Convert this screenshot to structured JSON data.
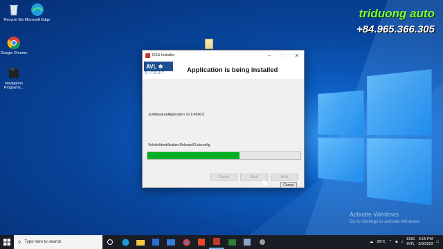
{
  "desktop": {
    "icons": [
      {
        "label": "Recycle Bin"
      },
      {
        "label": "Microsoft Edge"
      },
      {
        "label": "Google Chrome"
      },
      {
        "label": "Navigation Programs..."
      }
    ]
  },
  "watermark": {
    "title": "triduong auto",
    "phone": "+84.965.366.305"
  },
  "activation": {
    "line1": "Activate Windows",
    "line2": "Go to Settings to activate Windows."
  },
  "installer": {
    "window_title": "DSS Installer",
    "brand_top": "AVL",
    "brand_bottom": "DITEST",
    "heading": "Application is being installed",
    "current_app": "JLRMeasureApplication V2.6.4096.0",
    "current_file": "VehicleIdentification.Release63.dxconfig",
    "progress_fraction": 0.6,
    "buttons": {
      "cancel": "Cancel",
      "back": "Back",
      "next": "Next"
    },
    "cancel_overlay": "Cancel",
    "colors": {
      "progress": "#06b025",
      "brand": "#1f4e8f"
    }
  },
  "taskbar": {
    "search_placeholder": "Type here to search",
    "tray": {
      "weather": "29°C",
      "lang_top": "ENG",
      "lang_bottom": "INTL",
      "time": "9:15 PM",
      "date": "2/9/2023"
    }
  }
}
